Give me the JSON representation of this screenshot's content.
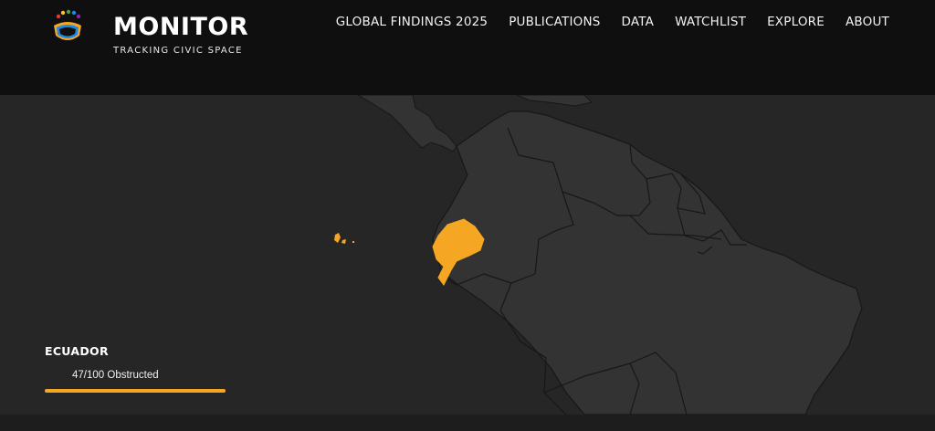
{
  "brand": {
    "title": "MONITOR",
    "subtitle": "TRACKING CIVIC SPACE"
  },
  "nav": [
    {
      "label": "GLOBAL FINDINGS 2025"
    },
    {
      "label": "PUBLICATIONS"
    },
    {
      "label": "DATA"
    },
    {
      "label": "WATCHLIST"
    },
    {
      "label": "EXPLORE"
    },
    {
      "label": "ABOUT"
    }
  ],
  "country_panel": {
    "name": "ECUADOR",
    "rating_text": "47/100 Obstructed",
    "score_fraction": 1.0
  },
  "colors": {
    "header_bg": "#0f0f0f",
    "map_bg": "#262626",
    "land": "#333333",
    "border": "#171717",
    "highlight": "#f5a623"
  }
}
